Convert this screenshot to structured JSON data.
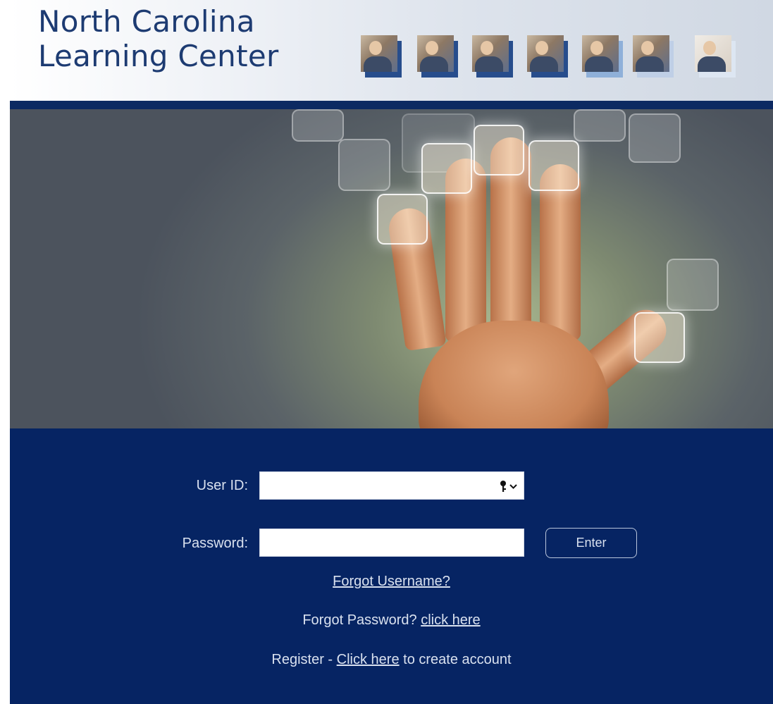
{
  "header": {
    "logo_line1": "North Carolina",
    "logo_line2": "Learning Center",
    "photo_icons": [
      "people-photo-1",
      "people-photo-2",
      "people-photo-3",
      "people-photo-4",
      "people-photo-5",
      "people-photo-6",
      "people-photo-7"
    ]
  },
  "colors": {
    "brand_navy": "#062463",
    "logo_blue": "#1d3b72",
    "text_light": "#d9e1ef"
  },
  "login": {
    "user_id_label": "User ID:",
    "user_id_value": "",
    "password_label": "Password:",
    "password_value": "",
    "enter_label": "Enter",
    "forgot_username": "Forgot Username?",
    "forgot_password_prefix": "Forgot Password?",
    "forgot_password_link": "click here",
    "register_prefix": "Register -",
    "register_link": "Click here",
    "register_suffix": "to create account",
    "key_icon": "password-key-icon"
  }
}
